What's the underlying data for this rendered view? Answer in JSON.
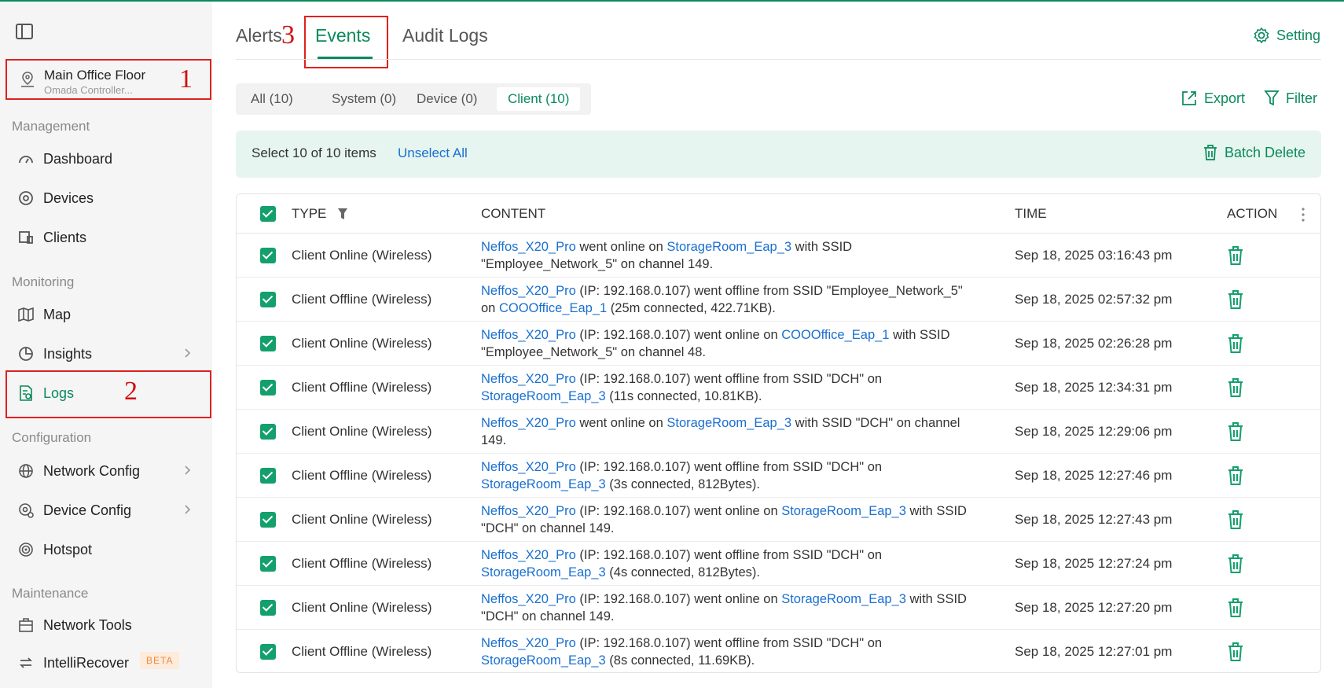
{
  "sidebar": {
    "site": {
      "name": "Main Office Floor",
      "subtitle": "Omada Controller..."
    },
    "sections": {
      "management": "Management",
      "monitoring": "Monitoring",
      "configuration": "Configuration",
      "maintenance": "Maintenance"
    },
    "items": [
      {
        "label": "Dashboard",
        "icon": "dashboard-icon"
      },
      {
        "label": "Devices",
        "icon": "devices-icon"
      },
      {
        "label": "Clients",
        "icon": "clients-icon"
      },
      {
        "label": "Map",
        "icon": "map-icon"
      },
      {
        "label": "Insights",
        "icon": "insights-icon"
      },
      {
        "label": "Logs",
        "icon": "logs-icon",
        "active": true
      },
      {
        "label": "Network Config",
        "icon": "globe-icon"
      },
      {
        "label": "Device Config",
        "icon": "device-config-icon"
      },
      {
        "label": "Hotspot",
        "icon": "hotspot-icon"
      },
      {
        "label": "Network Tools",
        "icon": "toolbox-icon"
      },
      {
        "label": "IntelliRecover",
        "icon": "recover-icon",
        "badge": "BETA"
      }
    ]
  },
  "annotations": {
    "one": "1",
    "two": "2",
    "three": "3"
  },
  "tabs": [
    {
      "label": "Alerts"
    },
    {
      "label": "Events",
      "active": true
    },
    {
      "label": "Audit Logs"
    }
  ],
  "setting_label": "Setting",
  "filters": [
    {
      "label": "All (10)"
    },
    {
      "label": "System (0)"
    },
    {
      "label": "Device (0)"
    },
    {
      "label": "Client (10)",
      "active": true
    }
  ],
  "actions": {
    "export": "Export",
    "filter": "Filter"
  },
  "selection": {
    "text": "Select 10 of 10 items",
    "unselect": "Unselect All",
    "batch_delete": "Batch Delete"
  },
  "table": {
    "headers": {
      "type": "TYPE",
      "content": "CONTENT",
      "time": "TIME",
      "action": "ACTION"
    },
    "rows": [
      {
        "type": "Client Online (Wireless)",
        "c": [
          [
            "Neffos_X20_Pro",
            true
          ],
          [
            " went online on ",
            false
          ],
          [
            "StorageRoom_Eap_3",
            true
          ],
          [
            " with SSID \"Employee_Network_5\" on channel 149.",
            false
          ]
        ],
        "time": "Sep 18, 2025 03:16:43 pm"
      },
      {
        "type": "Client Offline (Wireless)",
        "c": [
          [
            "Neffos_X20_Pro",
            true
          ],
          [
            " (IP: 192.168.0.107) went offline from SSID \"Employee_Network_5\" on ",
            false
          ],
          [
            "COOOffice_Eap_1",
            true
          ],
          [
            " (25m connected, 422.71KB).",
            false
          ]
        ],
        "time": "Sep 18, 2025 02:57:32 pm"
      },
      {
        "type": "Client Online (Wireless)",
        "c": [
          [
            "Neffos_X20_Pro",
            true
          ],
          [
            " (IP: 192.168.0.107) went online on ",
            false
          ],
          [
            "COOOffice_Eap_1",
            true
          ],
          [
            " with SSID \"Employee_Network_5\" on channel 48.",
            false
          ]
        ],
        "time": "Sep 18, 2025 02:26:28 pm"
      },
      {
        "type": "Client Offline (Wireless)",
        "c": [
          [
            "Neffos_X20_Pro",
            true
          ],
          [
            " (IP: 192.168.0.107) went offline from SSID \"DCH\" on ",
            false
          ],
          [
            "StorageRoom_Eap_3",
            true
          ],
          [
            " (11s connected, 10.81KB).",
            false
          ]
        ],
        "time": "Sep 18, 2025 12:34:31 pm"
      },
      {
        "type": "Client Online (Wireless)",
        "c": [
          [
            "Neffos_X20_Pro",
            true
          ],
          [
            " went online on ",
            false
          ],
          [
            "StorageRoom_Eap_3",
            true
          ],
          [
            " with SSID \"DCH\" on channel 149.",
            false
          ]
        ],
        "time": "Sep 18, 2025 12:29:06 pm"
      },
      {
        "type": "Client Offline (Wireless)",
        "c": [
          [
            "Neffos_X20_Pro",
            true
          ],
          [
            " (IP: 192.168.0.107) went offline from SSID \"DCH\" on ",
            false
          ],
          [
            "StorageRoom_Eap_3",
            true
          ],
          [
            " (3s connected, 812Bytes).",
            false
          ]
        ],
        "time": "Sep 18, 2025 12:27:46 pm"
      },
      {
        "type": "Client Online (Wireless)",
        "c": [
          [
            "Neffos_X20_Pro",
            true
          ],
          [
            " (IP: 192.168.0.107) went online on ",
            false
          ],
          [
            "StorageRoom_Eap_3",
            true
          ],
          [
            " with SSID \"DCH\" on channel 149.",
            false
          ]
        ],
        "time": "Sep 18, 2025 12:27:43 pm"
      },
      {
        "type": "Client Offline (Wireless)",
        "c": [
          [
            "Neffos_X20_Pro",
            true
          ],
          [
            " (IP: 192.168.0.107) went offline from SSID \"DCH\" on ",
            false
          ],
          [
            "StorageRoom_Eap_3",
            true
          ],
          [
            " (4s connected, 812Bytes).",
            false
          ]
        ],
        "time": "Sep 18, 2025 12:27:24 pm"
      },
      {
        "type": "Client Online (Wireless)",
        "c": [
          [
            "Neffos_X20_Pro",
            true
          ],
          [
            " (IP: 192.168.0.107) went online on ",
            false
          ],
          [
            "StorageRoom_Eap_3",
            true
          ],
          [
            " with SSID \"DCH\" on channel 149.",
            false
          ]
        ],
        "time": "Sep 18, 2025 12:27:20 pm"
      },
      {
        "type": "Client Offline (Wireless)",
        "c": [
          [
            "Neffos_X20_Pro",
            true
          ],
          [
            " (IP: 192.168.0.107) went offline from SSID \"DCH\" on ",
            false
          ],
          [
            "StorageRoom_Eap_3",
            true
          ],
          [
            " (8s connected, 11.69KB).",
            false
          ]
        ],
        "time": "Sep 18, 2025 12:27:01 pm"
      }
    ]
  },
  "colors": {
    "accent": "#0a8a5b",
    "link": "#1a6fd1",
    "annotation": "#e02020"
  }
}
